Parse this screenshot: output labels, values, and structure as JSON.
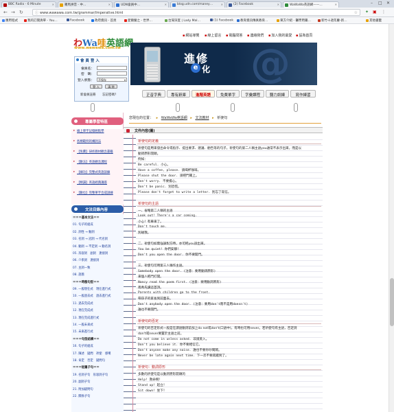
{
  "browser": {
    "tabs": [
      {
        "title": "BBC Radio - 6 Minute",
        "color": "#b30000"
      },
      {
        "title": "羅馬拼音 - 中…",
        "color": "#e6a100"
      },
      {
        "title": "UDN會員中…",
        "color": "#2d6fd0"
      },
      {
        "title": "blog.udn.com/maney…",
        "color": "#3a7bd5"
      },
      {
        "title": "(2) Facebook",
        "color": "#3b5998"
      },
      {
        "title": "WaWaWa英語網——…",
        "color": "#2e8b3a"
      }
    ],
    "url": "www.wawawa.com.tw/grammar/Imperative.html",
    "bookmarks": [
      {
        "label": "應用程式",
        "color": "#4285f4"
      },
      {
        "label": "我的訂閱清單 - You…",
        "color": "#e62117"
      },
      {
        "label": "Facebook",
        "color": "#3b5998"
      },
      {
        "label": "政府資訊 - 首頁",
        "color": "#1a73e8"
      },
      {
        "label": "愛爾蘭之 - 世界…",
        "color": "#e62117"
      },
      {
        "label": "台灣深度 | Lady Mal…",
        "color": "#6aa84f"
      },
      {
        "label": "(1) Facebook",
        "color": "#3b5998"
      },
      {
        "label": "教育資訊傳真教育…",
        "color": "#2d6fd0"
      },
      {
        "label": "東方介紹 - 醫學用藥…",
        "color": "#e6a100"
      },
      {
        "label": "新竹十週年慶-新…",
        "color": "#c23b22"
      },
      {
        "label": "其他書籤",
        "color": "#e6a100"
      }
    ]
  },
  "topnav": [
    "網站導覽",
    "線上留言",
    "電腦問答",
    "連絡我們",
    "加入我的最愛",
    "設為首頁"
  ],
  "logo": {
    "chars": [
      "わ",
      "Wa",
      "哇",
      "英語網"
    ],
    "url": "www.wawawa.com.tw"
  },
  "banner": {
    "title": "進修",
    "e": "e",
    "title2": "化"
  },
  "login": {
    "header": "會 員 登 入",
    "account_label": "會員名：",
    "password_label": "密　碼：",
    "status_label": "登入狀態：",
    "status_value": "不保存",
    "login_button": "登 入",
    "clear_button": "清 除",
    "register_link": "新會員註冊",
    "forgot_link": "忘記密碼？"
  },
  "menu": [
    "正音字典",
    "專有辭庫",
    "進階英語",
    "免費單字",
    "字彙課程",
    "聽力訓練",
    "寫作練習"
  ],
  "sidebar": {
    "pink_header": "專屬學習特區",
    "pink_items": [
      "線上單字記憶輕鬆學",
      "各類範例的構詞法",
      "【免費】研析教材觀念書籍",
      "【數法】英語觀念課程",
      "【練功】完整式英語訓練",
      "【精讀】英語經典講座",
      "【數位】完整單字合成訓練"
    ],
    "blue_header": "文法目錄內容",
    "blue_items": [
      {
        "text": "＝＝＝基本文法＝＝",
        "sec": true
      },
      {
        "text": "01. 句子的組成",
        "sec": false
      },
      {
        "text": "02. 詞性 → 動詞",
        "sec": false
      },
      {
        "text": "03. 名詞 → 冠詞 → 代名詞",
        "sec": false
      },
      {
        "text": "04. 動詞 → 不定詞 → 動名詞",
        "sec": false
      },
      {
        "text": "05. 形容詞　副詞　連接詞",
        "sec": false
      },
      {
        "text": "06. 介系詞　連接詞",
        "sec": false
      },
      {
        "text": "07. 主詞一致",
        "sec": false
      },
      {
        "text": "08. 語態",
        "sec": false
      },
      {
        "text": "＝＝＝時態句型＝＝",
        "sec": true
      },
      {
        "text": "09. 一般現在式　現在進行式",
        "sec": false
      },
      {
        "text": "10. 一般過去式　過去進行式",
        "sec": false
      },
      {
        "text": "11. 過去完成式",
        "sec": false
      },
      {
        "text": "12. 現在完成式",
        "sec": false
      },
      {
        "text": "13. 現在完成進行式",
        "sec": false
      },
      {
        "text": "14. 一般未來式",
        "sec": false
      },
      {
        "text": "15. 未來進行式",
        "sec": false
      },
      {
        "text": "＝＝＝句型結構＝＝",
        "sec": true
      },
      {
        "text": "16. 句子的組成",
        "sec": false
      },
      {
        "text": "17. 陳述　疑問　祈使　感嘆",
        "sec": false
      },
      {
        "text": "18. 肯定　否定　疑問句",
        "sec": false
      },
      {
        "text": "＝＝＝從屬子句＝＝",
        "sec": true
      },
      {
        "text": "19. 名詞子句　形容詞子句",
        "sec": false
      },
      {
        "text": "20. 副詞子句",
        "sec": false
      },
      {
        "text": "21. 附加疑問句",
        "sec": false
      },
      {
        "text": "22. 關係子句",
        "sec": false
      }
    ]
  },
  "breadcrumb": {
    "prefix": "您現在的位置：",
    "items": [
      "WaWaWa英語網",
      "文法教材",
      "祈使句"
    ]
  },
  "chapter": {
    "title": "文件內容(圖)"
  },
  "sections": [
    {
      "title": "祈使句的定義",
      "lines": [
        {
          "t": "祈使句是用來發出命令或指示、提出要求、建議、勸告等的句子。祈使句的第二人稱主語you通常不表示出來，而是以",
          "cjk": true
        },
        {
          "t": "動詞原形開頭。",
          "cjk": true
        },
        {
          "t": "例如：",
          "cjk": true
        },
        {
          "t": "Be careful. 小心。",
          "cjk": false
        },
        {
          "t": "Have a coffee, please. 請喝杯咖啡。",
          "cjk": false
        },
        {
          "t": "Please shut the door. 請把門關上。",
          "cjk": false
        },
        {
          "t": "Don't worry. 不要擔心。",
          "cjk": false
        },
        {
          "t": "Don't be panic. 別恐慌。",
          "cjk": false
        },
        {
          "t": "Please don't forget to write a letter. 別忘了寫信。",
          "cjk": false
        }
      ]
    },
    {
      "title": "祈使句的主語",
      "lines": [
        {
          "t": "一、省略第二人稱的主語",
          "cjk": true
        },
        {
          "t": "Look out! There's a car coming.",
          "cjk": false
        },
        {
          "t": "小心！有車來了。",
          "cjk": true
        },
        {
          "t": "Don't touch me.",
          "cjk": false
        },
        {
          "t": "別碰我。",
          "cjk": true
        },
        {
          "t": "",
          "cjk": true
        },
        {
          "t": "二、祈使句如需強調對方時，亦可把you說出來。",
          "cjk": true
        },
        {
          "t": "You be quiet! 你們安靜！",
          "cjk": false
        },
        {
          "t": "Don't you open the door. 你不要開門。",
          "cjk": false
        },
        {
          "t": "",
          "cjk": true
        },
        {
          "t": "三、祈使句可用第三人稱作主語。",
          "cjk": true
        },
        {
          "t": "Somebody open the door. (注意：要用動詞原形)",
          "cjk": false
        },
        {
          "t": "來個人把門打開。",
          "cjk": true
        },
        {
          "t": "Nancy read the poem first. (注意：要用動詞原形)",
          "cjk": false
        },
        {
          "t": "南希先讀這首詩。",
          "cjk": true
        },
        {
          "t": "Parents with children go to the front.",
          "cjk": false
        },
        {
          "t": "帶孩子的家長到前面去。",
          "cjk": true
        },
        {
          "t": "Don't anybody open the door. (注意：要用don't而不是用doesn't)",
          "cjk": false
        },
        {
          "t": "誰也不要開門。",
          "cjk": true
        }
      ]
    },
    {
      "title": "祈使句的否定",
      "lines": [
        {
          "t": "祈使句的否定形式一般是在謂語動詞前加上do not或don't(口語中)，有時也可用never。若祈使句有主語，否定詞",
          "cjk": true
        },
        {
          "t": "don't或never要置於主語之前。",
          "cjk": true
        },
        {
          "t": "Do not come in unless asked. 非請莫入。",
          "cjk": false
        },
        {
          "t": "Don't you believe it. 你不要相信它。",
          "cjk": false
        },
        {
          "t": "Don't anyone make any noise. 誰也不要吵吵鬧鬧。",
          "cjk": false
        },
        {
          "t": "Never be late again next time. 下一次不要再遲到了。",
          "cjk": false
        }
      ]
    },
    {
      "title": "祈使句：動詞原形",
      "lines": [
        {
          "t": "多數的祈使句是以動詞原形開頭的",
          "cjk": true
        },
        {
          "t": "Help! 救命啊！",
          "cjk": false
        },
        {
          "t": "Stand up! 起立！",
          "cjk": false
        },
        {
          "t": "Sit down! 坐下！",
          "cjk": false
        }
      ]
    }
  ]
}
